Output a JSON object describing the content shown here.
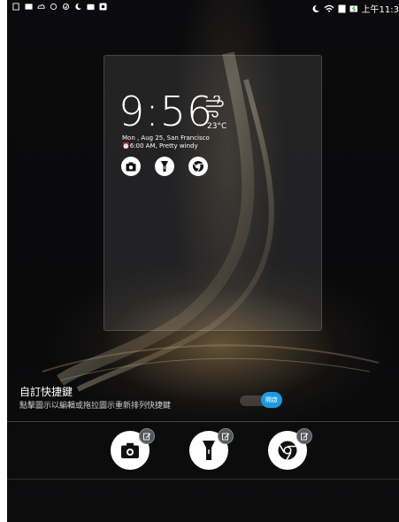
{
  "status_bar": {
    "left_icons": [
      "sim-icon",
      "image-icon",
      "cloud-icon",
      "sync-icon",
      "clipboard-icon",
      "moon-icon",
      "camera-icon",
      "notification-icon"
    ],
    "time": "上午11:3"
  },
  "preview": {
    "clock": "9:56",
    "temperature": "23°C",
    "weather_icon": "wind-icon",
    "date_line": "Mon , Aug 25, San Francisco",
    "alarm_line": "⏰6:00 AM, Pretty windy",
    "shortcut_icons": [
      "camera-icon",
      "flashlight-icon",
      "chrome-icon"
    ]
  },
  "custom_shortcuts": {
    "title": "自訂快捷鍵",
    "subtitle": "點擊圖示以編輯或拖拉圖示重新排列快捷鍵",
    "toggle_label": "開啟",
    "toggle_on": true,
    "accent_color": "#1a9be0"
  },
  "shortcuts": [
    {
      "name": "camera",
      "icon": "camera-icon"
    },
    {
      "name": "flashlight",
      "icon": "flashlight-icon"
    },
    {
      "name": "chrome",
      "icon": "chrome-icon"
    }
  ]
}
